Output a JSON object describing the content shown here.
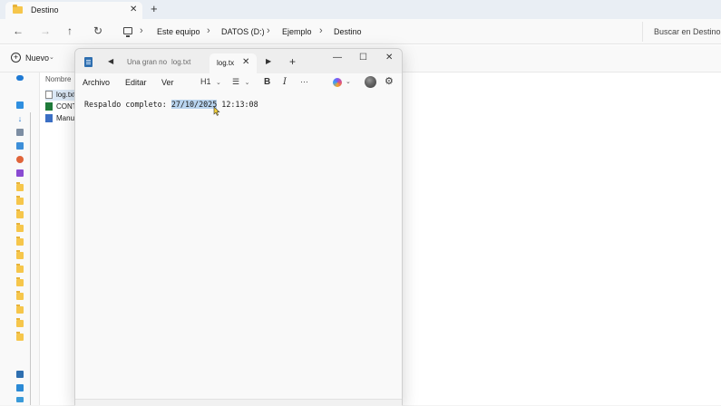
{
  "explorer": {
    "tab_title": "Destino",
    "breadcrumb": [
      "Este equipo",
      "DATOS (D:)",
      "Ejemplo",
      "Destino"
    ],
    "search_placeholder": "Buscar en Destino",
    "new_label": "Nuevo",
    "column_name": "Nombre",
    "files": [
      {
        "name": "log.txt",
        "icon": "text-file-icon",
        "selected": true
      },
      {
        "name": "CONT",
        "icon": "excel-file-icon",
        "selected": false
      },
      {
        "name": "Manu",
        "icon": "powershell-file-icon",
        "selected": false
      }
    ],
    "sidebar_icons": [
      "onedrive-icon",
      "desktop-icon",
      "downloads-icon",
      "documents-icon",
      "pictures-icon",
      "music-icon",
      "videos-icon",
      "folder-icon",
      "folder-icon",
      "folder-icon",
      "folder-icon",
      "folder-icon",
      "folder-icon",
      "folder-icon",
      "folder-icon",
      "folder-icon",
      "folder-icon",
      "folder-icon",
      "folder-icon",
      "this-pc-icon",
      "network-icon"
    ]
  },
  "notepad": {
    "tabs": [
      {
        "label": "Una gran no",
        "active": false
      },
      {
        "label": "log.txt",
        "active": false
      },
      {
        "label": "log.tx",
        "active": true
      }
    ],
    "menu": [
      "Archivo",
      "Editar",
      "Ver"
    ],
    "heading_label": "H1",
    "bold_label": "B",
    "italic_label": "I",
    "more_label": "···",
    "content": {
      "prefix": "Respaldo completo: ",
      "highlight": "27/10/2025",
      "suffix": " 12:13:08"
    }
  },
  "colors": {
    "accent": "#2f6fb0",
    "selection": "#b9d4ef",
    "folder": "#f6c64b"
  }
}
